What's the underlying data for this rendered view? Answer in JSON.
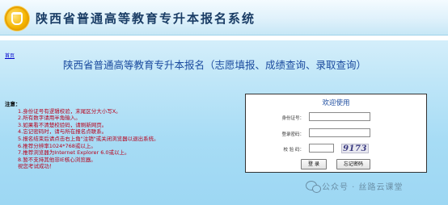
{
  "header": {
    "title": "陕西省普通高等教育专升本报名系统",
    "logo_icon": "education-emblem-icon"
  },
  "main": {
    "home_link": "首页",
    "heading": "陕西省普通高等教育专升本报名（志愿填报、成绩查询、录取查询）"
  },
  "notes": {
    "title": "注意：",
    "items": [
      "1.身份证号有逻辑校验，末尾区分大小写X。",
      "2.所有数字请用半角输入。",
      "3.如果看不清楚校验码，请刷新网页。",
      "4.忘记密码时，请与所在报名点联系。",
      "5.报名结束后请点击右上角\"注销\"或关闭浏览器以退出系统。",
      "6.推荐分辨率1024*768或以上。",
      "7.推荐浏览器为Internet Explorer 6.0或以上。",
      "8.暂不支持其他非IE核心浏览器。",
      "祝您考试成功！"
    ]
  },
  "login": {
    "title": "欢迎使用",
    "id_label": "身份证号：",
    "id_value": "",
    "password_label": "登录密码：",
    "password_value": "",
    "captcha_label": "校 验 码：",
    "captcha_value": "",
    "captcha_text": "9173",
    "login_button": "登 录",
    "forgot_button": "忘记密码"
  },
  "watermark": {
    "icon": "wechat-icon",
    "text": "公众号 · 丝路云课堂"
  },
  "colors": {
    "heading": "#1a4a9e",
    "notes": "#b8001c",
    "background": "#a7dcf5",
    "title": "#1a3d66"
  }
}
